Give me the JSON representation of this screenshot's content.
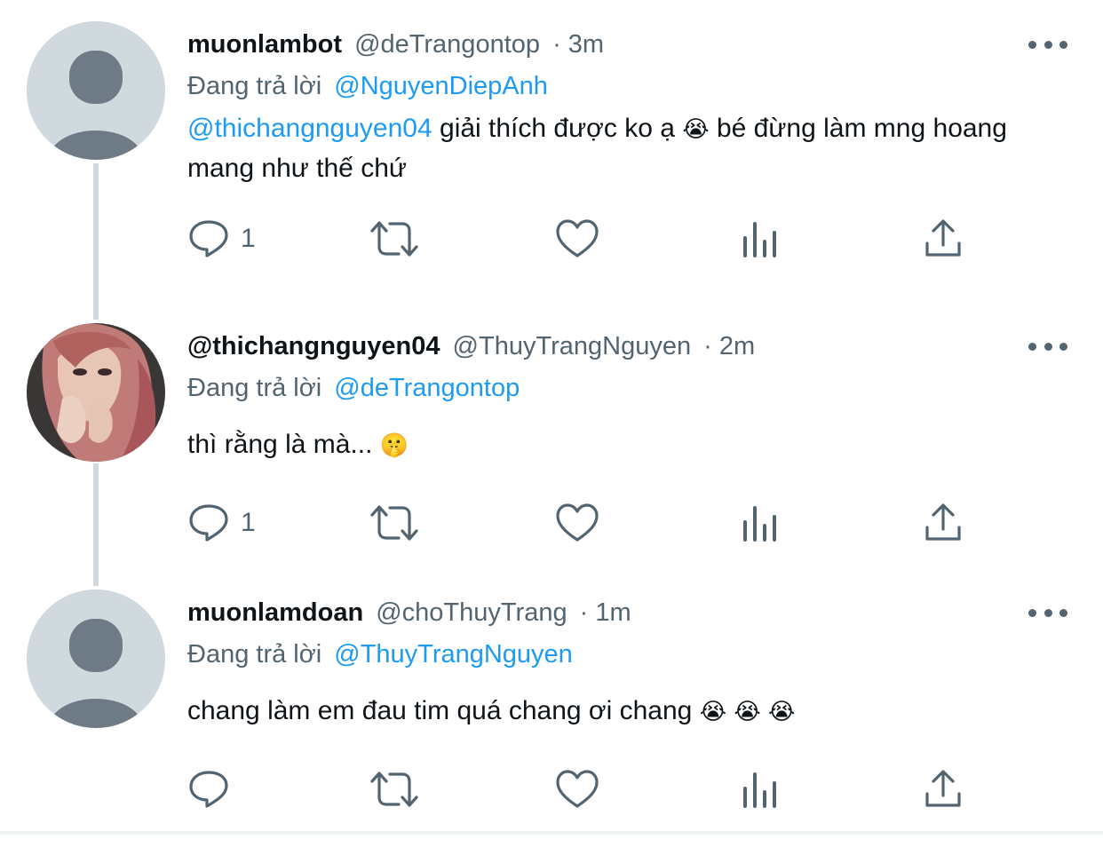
{
  "colors": {
    "link": "#1d9bf0",
    "secondary_text": "#536471",
    "thread_line": "#cfd9de",
    "avatar_placeholder_bg": "#cfd9de",
    "avatar_placeholder_fg": "#6e7a85"
  },
  "tweets": [
    {
      "display_name": "muonlambot",
      "handle": "@deTrangontop",
      "time": "· 3m",
      "reply_prefix": "Đang trả lời",
      "reply_to": "@NguyenDiepAnh",
      "mention": "@thichangnguyen04",
      "text": " giải thích được ko ạ ",
      "emoji": "😭",
      "text_after": "  bé đừng làm mng hoang mang như thế chứ",
      "avatar": "default-avatar",
      "reply_count": "1"
    },
    {
      "display_name": "@thichangnguyen04",
      "handle": "@ThuyTrangNguyen",
      "time": "· 2m",
      "reply_prefix": "Đang trả lời",
      "reply_to": "@deTrangontop",
      "text": "thì rằng là mà... ",
      "emoji": "🤫",
      "avatar": "profile-photo",
      "reply_count": "1"
    },
    {
      "display_name": "muonlamdoan",
      "handle": "@choThuyTrang",
      "time": "· 1m",
      "reply_prefix": "Đang trả lời",
      "reply_to": "@ThuyTrangNguyen",
      "text": "chang làm em đau tim quá chang ơi chang ",
      "emoji": "😭 😭 😭",
      "avatar": "default-avatar",
      "reply_count": ""
    }
  ],
  "icons": {
    "reply": "reply-icon",
    "retweet": "retweet-icon",
    "like": "like-icon",
    "views": "views-icon",
    "share": "share-icon",
    "more": "more-icon"
  }
}
